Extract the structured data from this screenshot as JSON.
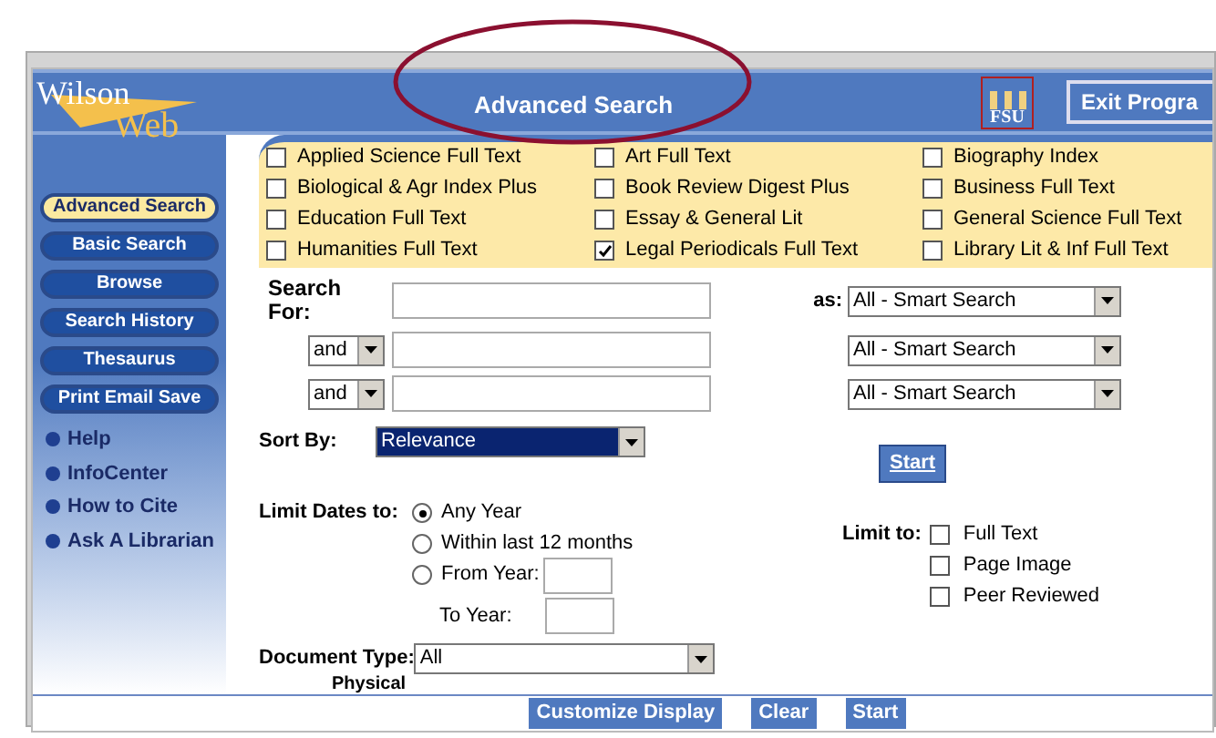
{
  "window": {
    "title": "Advanced Search"
  },
  "logo": {
    "top": "Wilson",
    "bottom": "Web",
    "badge": "FSU"
  },
  "exit_button": "Exit Progra",
  "sidebar": {
    "buttons": [
      {
        "label": "Advanced Search",
        "selected": true
      },
      {
        "label": "Basic Search",
        "selected": false
      },
      {
        "label": "Browse",
        "selected": false
      },
      {
        "label": "Search History",
        "selected": false
      },
      {
        "label": "Thesaurus",
        "selected": false
      },
      {
        "label": "Print Email Save",
        "selected": false
      }
    ],
    "links": [
      "Help",
      "InfoCenter",
      "How to Cite",
      "Ask A Librarian"
    ]
  },
  "databases": [
    {
      "label": "Applied Science Full Text",
      "checked": false
    },
    {
      "label": "Art Full Text",
      "checked": false
    },
    {
      "label": "Biography Index",
      "checked": false
    },
    {
      "label": "Biological & Agr Index Plus",
      "checked": false
    },
    {
      "label": "Book Review Digest Plus",
      "checked": false
    },
    {
      "label": "Business Full Text",
      "checked": false
    },
    {
      "label": "Education Full Text",
      "checked": false
    },
    {
      "label": "Essay & General Lit",
      "checked": false
    },
    {
      "label": "General Science Full Text",
      "checked": false
    },
    {
      "label": "Humanities Full Text",
      "checked": false
    },
    {
      "label": "Legal Periodicals Full Text",
      "checked": true
    },
    {
      "label": "Library Lit & Inf Full Text",
      "checked": false
    }
  ],
  "search": {
    "label": "Search For:",
    "as_label": "as:",
    "rows": [
      {
        "connector": null,
        "field_type": "All - Smart Search"
      },
      {
        "connector": "and",
        "field_type": "All - Smart Search"
      },
      {
        "connector": "and",
        "field_type": "All - Smart Search"
      }
    ]
  },
  "sort_by": {
    "label": "Sort By:",
    "value": "Relevance"
  },
  "start_button": "Start",
  "limit_dates": {
    "label": "Limit Dates to:",
    "options": [
      {
        "label": "Any Year",
        "selected": true
      },
      {
        "label": "Within last 12 months",
        "selected": false
      },
      {
        "label": "From Year:",
        "selected": false
      }
    ],
    "to_year_label": "To Year:"
  },
  "limit_to": {
    "label": "Limit to:",
    "options": [
      {
        "label": "Full Text",
        "checked": false
      },
      {
        "label": "Page Image",
        "checked": false
      },
      {
        "label": "Peer Reviewed",
        "checked": false
      }
    ]
  },
  "document_type": {
    "label": "Document Type:",
    "value": "All"
  },
  "physical_label": "Physical",
  "footer_buttons": [
    "Customize Display",
    "Clear",
    "Start"
  ]
}
